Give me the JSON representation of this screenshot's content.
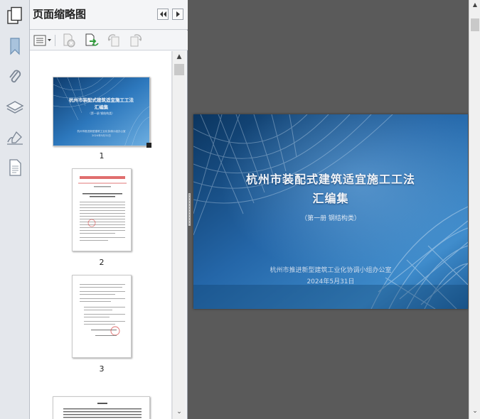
{
  "panel": {
    "title": "页面缩略图"
  },
  "icons": {
    "app": "pages-copy-icon",
    "rail": [
      "bookmark-icon",
      "attachment-icon",
      "layers-icon",
      "signature-icon",
      "page-icon"
    ],
    "toolbar": [
      "options-menu-icon",
      "delete-page-icon",
      "insert-page-icon",
      "rotate-left-icon",
      "rotate-right-icon"
    ]
  },
  "thumbnails": [
    {
      "page": "1",
      "selected": true
    },
    {
      "page": "2"
    },
    {
      "page": "3"
    }
  ],
  "slide": {
    "title_line1": "杭州市装配式建筑适宜施工工法",
    "title_line2": "汇编集",
    "subtitle": "（第一册  钢结构类）",
    "org": "杭州市推进新型建筑工业化协调小组办公室",
    "date": "2024年5月31日"
  },
  "colors": {
    "viewer_bg": "#5a5a5a",
    "slide_dark": "#0d3f72",
    "slide_light": "#3a86c8"
  }
}
